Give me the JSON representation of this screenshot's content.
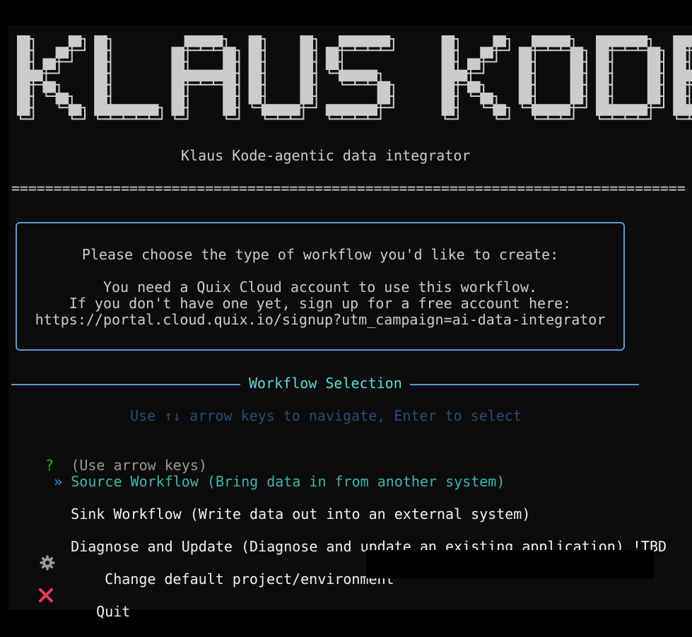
{
  "banner": {
    "title": "KLAUS KODE",
    "color": "#cccccc"
  },
  "subtitle": "Klaus Kode-agentic data integrator",
  "separator": "================================================================================",
  "info_box": {
    "line1": "Please choose the type of workflow you'd like to create:",
    "line2": "You need a Quix Cloud account to use this workflow.",
    "line3": "If you don't have one yet, sign up for a free account here:",
    "line4": "https://portal.cloud.quix.io/signup?utm_campaign=ai-data-integrator",
    "border_color": "#5a9bd6"
  },
  "section": {
    "title": "Workflow Selection"
  },
  "hint": "Use ↑↓ arrow keys to navigate, Enter to select",
  "prompt": {
    "marker": "?",
    "text": "(Use arrow keys)"
  },
  "options": [
    {
      "pointer": "»",
      "label": "Source Workflow (Bring data in from another system)",
      "selected": true
    },
    {
      "label": "Sink Workflow (Write data out into an external system)"
    },
    {
      "label": "Diagnose and Update (Diagnose and update an existing application) !TBD"
    },
    {
      "icon": "gear-icon",
      "label": "Change default project/environment"
    },
    {
      "icon": "cross-mark-icon",
      "label": "Quit"
    }
  ]
}
